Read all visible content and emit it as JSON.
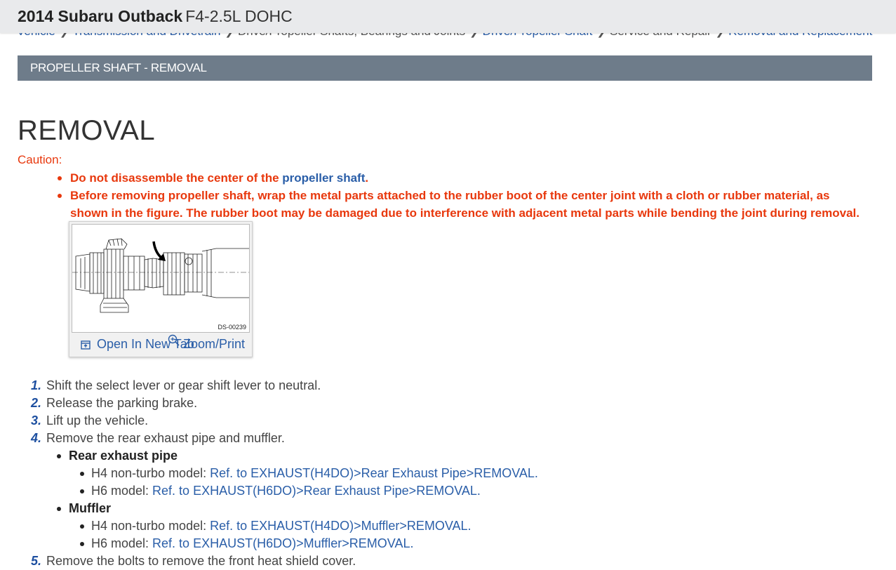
{
  "header": {
    "vehicle": "2014 Subaru Outback",
    "engine": "F4-2.5L DOHC"
  },
  "breadcrumb": [
    {
      "label": "Vehicle",
      "link": true
    },
    {
      "label": "Transmission and Drivetrain",
      "link": true
    },
    {
      "label": "Drive/Propeller Shafts, Bearings and Joints",
      "link": false
    },
    {
      "label": "Drive/Propeller Shaft",
      "link": true
    },
    {
      "label": "Service and Repair",
      "link": false
    },
    {
      "label": "Removal and Replacement",
      "link": true
    }
  ],
  "section_banner": "PROPELLER SHAFT - REMOVAL",
  "heading": "REMOVAL",
  "caution": {
    "label": "Caution:",
    "item1_pre": "Do not disassemble the center of the ",
    "item1_link": "propeller shaft",
    "item1_post": ".",
    "item2": "Before removing propeller shaft, wrap the metal parts attached to the rubber boot of the center joint with a cloth or rubber material, as shown in the figure. The rubber boot may be damaged due to interference with adjacent metal parts while bending the joint during removal."
  },
  "figure": {
    "code": "DS-00239",
    "open_tab": "Open In New Tab",
    "zoom_print": "Zoom/Print"
  },
  "steps": [
    {
      "num": "1.",
      "text": "Shift the select lever or gear shift lever to neutral."
    },
    {
      "num": "2.",
      "text": "Release the parking brake."
    },
    {
      "num": "3.",
      "text": "Lift up the vehicle."
    },
    {
      "num": "4.",
      "text": "Remove the rear exhaust pipe and muffler."
    },
    {
      "num": "5.",
      "text": "Remove the bolts to remove the front heat shield cover."
    }
  ],
  "step4_subs": {
    "rear_exhaust": {
      "label": "Rear exhaust pipe",
      "h4_prefix": "H4 non-turbo model: ",
      "h4_link": "Ref. to EXHAUST(H4DO)>Rear Exhaust Pipe>REMOVAL.",
      "h6_prefix": "H6 model: ",
      "h6_link": "Ref. to EXHAUST(H6DO)>Rear Exhaust Pipe>REMOVAL."
    },
    "muffler": {
      "label": "Muffler",
      "h4_prefix": "H4 non-turbo model: ",
      "h4_link": "Ref. to EXHAUST(H4DO)>Muffler>REMOVAL.",
      "h6_prefix": "H6 model: ",
      "h6_link": "Ref. to EXHAUST(H6DO)>Muffler>REMOVAL."
    }
  },
  "colors": {
    "caution": "#e8380d",
    "link": "#2a5ea8",
    "banner": "#6e7c8a",
    "step_number": "#1d4fa0"
  }
}
